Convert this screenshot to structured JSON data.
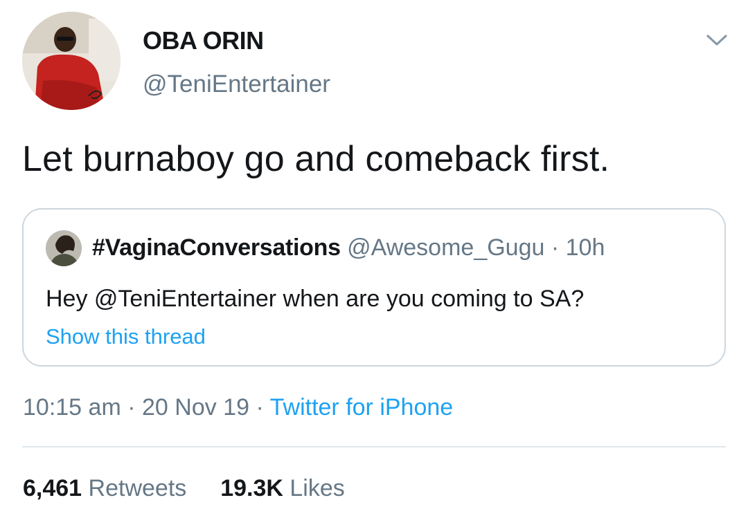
{
  "author": {
    "display_name": "OBA ORIN",
    "handle": "@TeniEntertainer"
  },
  "tweet": {
    "text": "Let burnaboy go and comeback first."
  },
  "quoted_tweet": {
    "display_name": "#VaginaConversations",
    "handle": "@Awesome_Gugu",
    "separator": "·",
    "time": "10h",
    "text": "Hey @TeniEntertainer when are you coming to SA?",
    "show_thread_label": "Show this thread"
  },
  "meta": {
    "time": "10:15 am",
    "separator": "·",
    "date": "20 Nov 19",
    "source": "Twitter for iPhone"
  },
  "stats": {
    "retweets_count": "6,461",
    "retweets_label": "Retweets",
    "likes_count": "19.3K",
    "likes_label": "Likes"
  },
  "icons": {
    "more": "chevron-down-icon"
  },
  "colors": {
    "link": "#1da1f2",
    "secondary_text": "#657786",
    "primary_text": "#14171a",
    "border": "#ccd6dd"
  }
}
